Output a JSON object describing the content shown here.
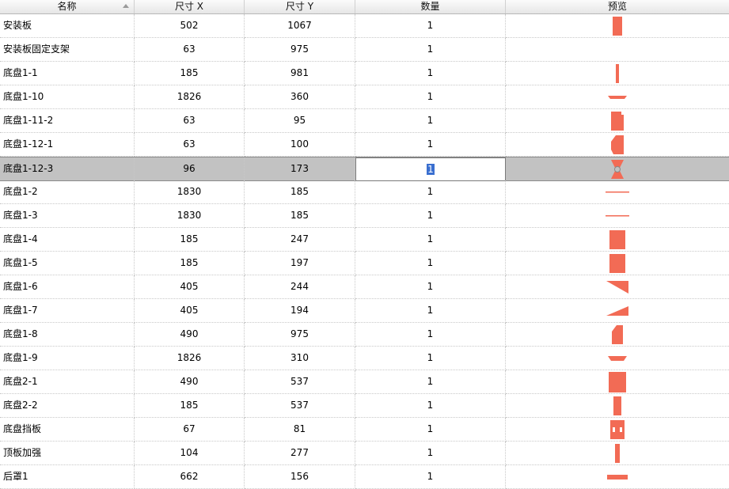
{
  "columns": {
    "name": "名称",
    "size_x": "尺寸 X",
    "size_y": "尺寸 Y",
    "quantity": "数量",
    "preview": "预览"
  },
  "preview_color": "#F26B55",
  "selected_row": 6,
  "rows": [
    {
      "name": "安装板",
      "x": "502",
      "y": "1067",
      "qty": "1",
      "shape": "tall-rect"
    },
    {
      "name": "安装板固定支架",
      "x": "63",
      "y": "975",
      "qty": "1",
      "shape": "none"
    },
    {
      "name": "底盘1-1",
      "x": "185",
      "y": "981",
      "qty": "1",
      "shape": "thin-vertical"
    },
    {
      "name": "底盘1-10",
      "x": "1826",
      "y": "360",
      "qty": "1",
      "shape": "wide-strip"
    },
    {
      "name": "底盘1-11-2",
      "x": "63",
      "y": "95",
      "qty": "1",
      "shape": "notched-rect"
    },
    {
      "name": "底盘1-12-1",
      "x": "63",
      "y": "100",
      "qty": "1",
      "shape": "chamfer-rect"
    },
    {
      "name": "底盘1-12-3",
      "x": "96",
      "y": "173",
      "qty": "1",
      "shape": "hourglass"
    },
    {
      "name": "底盘1-2",
      "x": "1830",
      "y": "185",
      "qty": "1",
      "shape": "line"
    },
    {
      "name": "底盘1-3",
      "x": "1830",
      "y": "185",
      "qty": "1",
      "shape": "line"
    },
    {
      "name": "底盘1-4",
      "x": "185",
      "y": "247",
      "qty": "1",
      "shape": "square"
    },
    {
      "name": "底盘1-5",
      "x": "185",
      "y": "197",
      "qty": "1",
      "shape": "square"
    },
    {
      "name": "底盘1-6",
      "x": "405",
      "y": "244",
      "qty": "1",
      "shape": "triangle-down"
    },
    {
      "name": "底盘1-7",
      "x": "405",
      "y": "194",
      "qty": "1",
      "shape": "triangle-up"
    },
    {
      "name": "底盘1-8",
      "x": "490",
      "y": "975",
      "qty": "1",
      "shape": "chamfer-tall"
    },
    {
      "name": "底盘1-9",
      "x": "1826",
      "y": "310",
      "qty": "1",
      "shape": "trapezoid"
    },
    {
      "name": "底盘2-1",
      "x": "490",
      "y": "537",
      "qty": "1",
      "shape": "square-large"
    },
    {
      "name": "底盘2-2",
      "x": "185",
      "y": "537",
      "qty": "1",
      "shape": "narrow-rect"
    },
    {
      "name": "底盘挡板",
      "x": "67",
      "y": "81",
      "qty": "1",
      "shape": "holed-rect"
    },
    {
      "name": "顶板加强",
      "x": "104",
      "y": "277",
      "qty": "1",
      "shape": "thin-bar"
    },
    {
      "name": "后罩1",
      "x": "662",
      "y": "156",
      "qty": "1",
      "shape": "small-bar"
    }
  ]
}
